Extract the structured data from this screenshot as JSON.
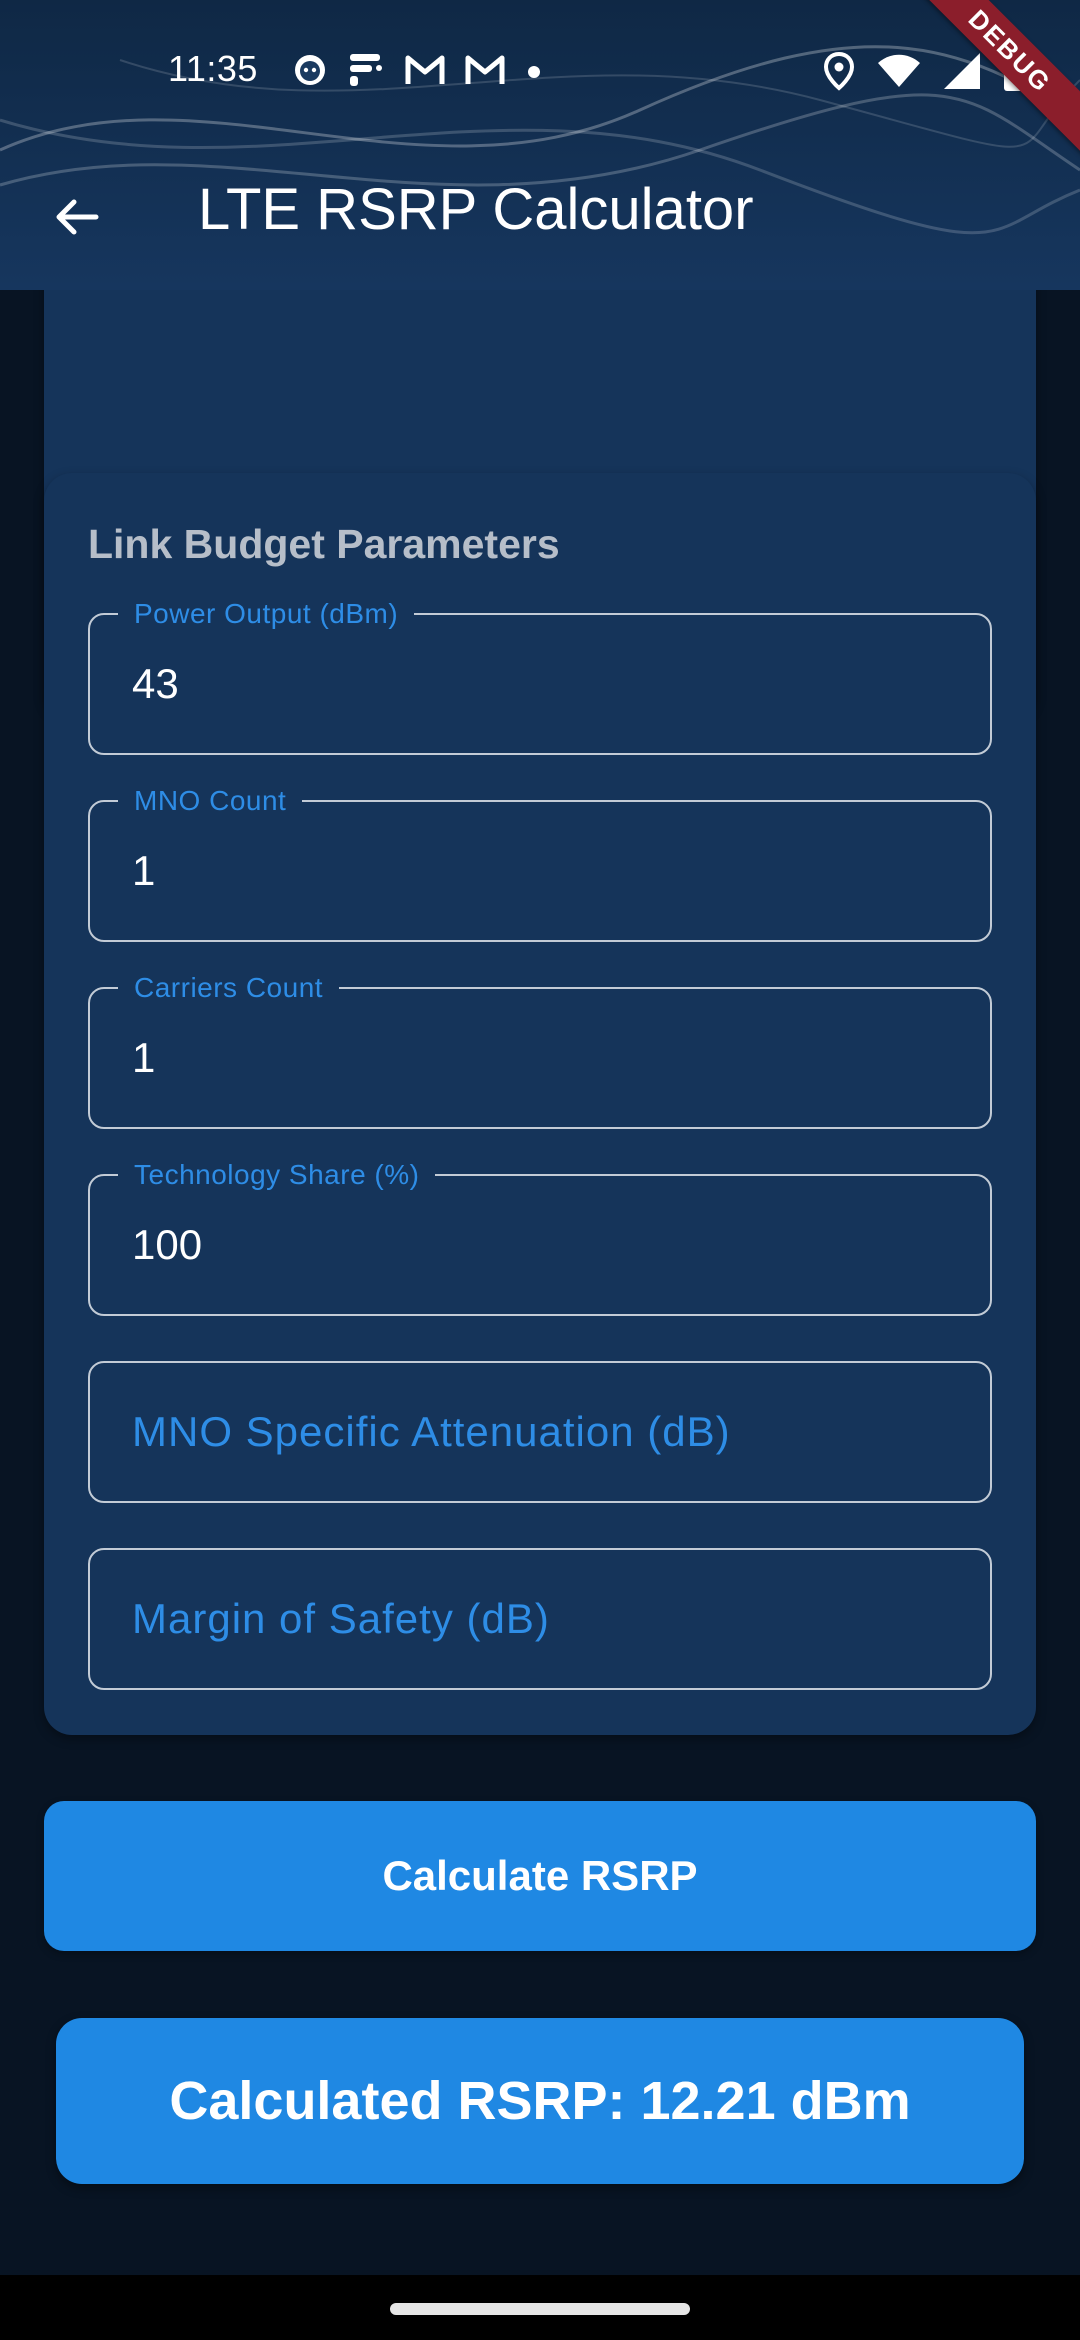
{
  "status_bar": {
    "time": "11:35",
    "left_icons": [
      "face-notification-icon",
      "feed-notification-icon",
      "gmail-icon",
      "gmail-icon",
      "more-notifications-dot-icon"
    ],
    "right_icons": [
      "location-icon",
      "wifi-icon",
      "cell-signal-icon",
      "battery-icon"
    ]
  },
  "debug_banner": "DEBUG",
  "app_bar": {
    "title": "LTE RSRP Calculator",
    "back_icon": "arrow-back-icon"
  },
  "link_budget": {
    "title": "Link Budget Parameters",
    "fields": [
      {
        "label": "Power Output (dBm)",
        "value": "43"
      },
      {
        "label": "MNO Count",
        "value": "1"
      },
      {
        "label": "Carriers Count",
        "value": "1"
      },
      {
        "label": "Technology Share (%)",
        "value": "100"
      },
      {
        "placeholder": "MNO Specific Attenuation (dB)",
        "value": ""
      },
      {
        "placeholder": "Margin of Safety (dB)",
        "value": ""
      }
    ]
  },
  "calculate_button": "Calculate RSRP",
  "result": "Calculated RSRP: 12.21 dBm",
  "colors": {
    "background": "#081423",
    "card": "#15345a",
    "accent": "#1f88e3",
    "label": "#2e8de6",
    "debug": "#8b1e2b"
  }
}
